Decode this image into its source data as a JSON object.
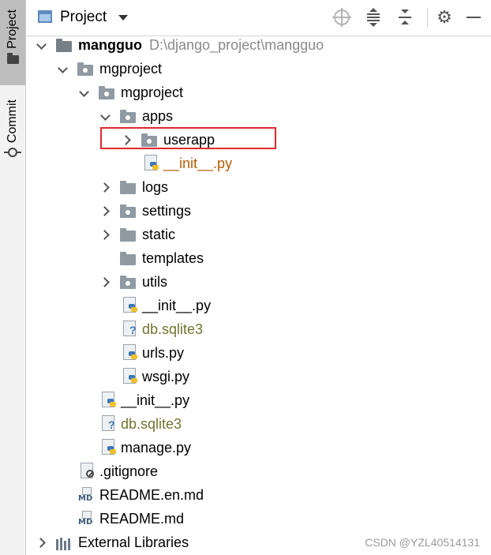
{
  "sidebar": {
    "tabs": [
      {
        "label": "Project",
        "icon": "folder-icon",
        "active": true
      },
      {
        "label": "Commit",
        "icon": "commit-icon",
        "active": false
      }
    ]
  },
  "header": {
    "title": "Project",
    "actions": [
      "locate-icon",
      "expand-all-icon",
      "collapse-all-icon",
      "gear-icon",
      "hide-icon"
    ]
  },
  "tree": {
    "items": [
      {
        "name": "mangguo",
        "path": "D:\\django_project\\mangguo",
        "type": "root-folder",
        "expanded": true
      },
      {
        "name": "mgproject",
        "type": "package",
        "expanded": true
      },
      {
        "name": "mgproject",
        "type": "package",
        "expanded": true
      },
      {
        "name": "apps",
        "type": "package",
        "expanded": true
      },
      {
        "name": "userapp",
        "type": "package",
        "expanded": false,
        "highlighted": true
      },
      {
        "name": "__init__.py",
        "type": "python",
        "color": "#b35c00"
      },
      {
        "name": "logs",
        "type": "folder",
        "expanded": false
      },
      {
        "name": "settings",
        "type": "package",
        "expanded": false
      },
      {
        "name": "static",
        "type": "folder",
        "expanded": false
      },
      {
        "name": "templates",
        "type": "folder"
      },
      {
        "name": "utils",
        "type": "package",
        "expanded": false
      },
      {
        "name": "__init__.py",
        "type": "python"
      },
      {
        "name": "db.sqlite3",
        "type": "unknown",
        "color": "#71752f"
      },
      {
        "name": "urls.py",
        "type": "python"
      },
      {
        "name": "wsgi.py",
        "type": "python"
      },
      {
        "name": "__init__.py",
        "type": "python"
      },
      {
        "name": "db.sqlite3",
        "type": "unknown",
        "color": "#71752f"
      },
      {
        "name": "manage.py",
        "type": "python"
      },
      {
        "name": ".gitignore",
        "type": "ignored"
      },
      {
        "name": "README.en.md",
        "type": "markdown"
      },
      {
        "name": "README.md",
        "type": "markdown"
      },
      {
        "name": "External Libraries",
        "type": "libraries",
        "expanded": false
      }
    ]
  },
  "watermark": "CSDN @YZL40514131",
  "colors": {
    "highlight_border": "#e0282e",
    "accent": "#5e8bbd"
  }
}
